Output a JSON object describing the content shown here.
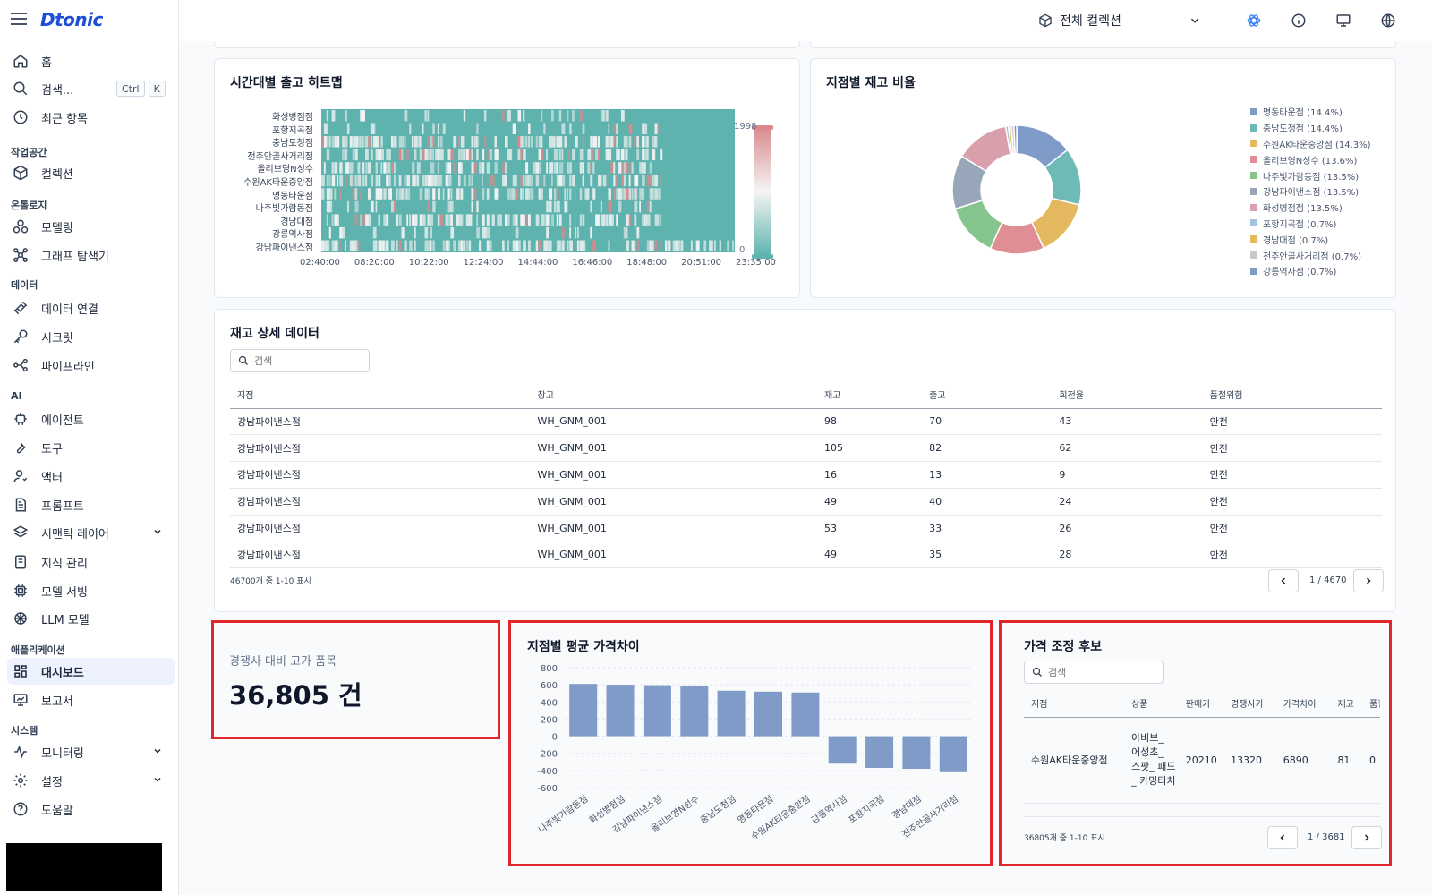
{
  "brand": {
    "name": "Dtonic"
  },
  "nav": {
    "home": "홈",
    "search": "검색...",
    "search_kbd_ctrl": "Ctrl",
    "search_kbd_k": "K",
    "recent": "최근 항목",
    "section_workspace": "작업공간",
    "collections": "컬렉션",
    "section_ontology": "온톨로지",
    "modeling": "모델링",
    "graph_explorer": "그래프 탐색기",
    "section_data": "데이터",
    "data_connection": "데이터 연결",
    "secrets": "시크릿",
    "pipeline": "파이프라인",
    "section_ai": "AI",
    "agent": "에이전트",
    "tools": "도구",
    "actor": "액터",
    "prompt": "프롬프트",
    "semantic_layer": "시맨틱 레이어",
    "knowledge": "지식 관리",
    "model_serving": "모델 서빙",
    "llm_model": "LLM 모델",
    "section_apps": "애플리케이션",
    "dashboard": "대시보드",
    "report": "보고서",
    "section_system": "시스템",
    "monitoring": "모니터링",
    "settings": "설정",
    "help": "도움말"
  },
  "topbar": {
    "collection_label": "전체 컬렉션"
  },
  "heatmap": {
    "title": "시간대별 출고 히트맵",
    "stores": [
      "화성병점점",
      "포항지곡점",
      "충남도청점",
      "전주안골사거리점",
      "올리브영N성수",
      "수원AK타운중앙점",
      "명동타운점",
      "나주빛가람동점",
      "경남대점",
      "강릉역사점",
      "강남파이낸스점"
    ],
    "times": [
      "02:40:00",
      "08:20:00",
      "10:22:00",
      "12:24:00",
      "14:44:00",
      "16:46:00",
      "18:48:00",
      "20:51:00",
      "23:35:00"
    ],
    "scale_max": "1998",
    "scale_min": "0",
    "colors": {
      "low": "#5fb3ae",
      "mid": "#f4f4f4",
      "high": "#d98a8d"
    }
  },
  "donut": {
    "title": "지점별 재고 비율",
    "chart_data": {
      "type": "pie",
      "title": "지점별 재고 비율",
      "labels": [
        "명동타운점",
        "충남도청점",
        "수원AK타운중앙점",
        "올리브영N성수",
        "나주빛가람동점",
        "강남파이낸스점",
        "화성병점점",
        "포항지곡점",
        "경남대점",
        "전주안골사거리점",
        "강릉역사점"
      ],
      "values": [
        14.4,
        14.4,
        14.3,
        13.6,
        13.5,
        13.5,
        13.5,
        0.7,
        0.7,
        0.7,
        0.7
      ],
      "legend": [
        "명동타운점 (14.4%)",
        "충남도청점 (14.4%)",
        "수원AK타운중앙점 (14.3%)",
        "올리브영N성수 (13.6%)",
        "나주빛가람동점 (13.5%)",
        "강남파이낸스점 (13.5%)",
        "화성병점점 (13.5%)",
        "포항지곡점 (0.7%)",
        "경남대점 (0.7%)",
        "전주안골사거리점 (0.7%)",
        "강릉역사점 (0.7%)"
      ],
      "colors": [
        "#7f9cc8",
        "#6dbab6",
        "#e3b85e",
        "#e08e95",
        "#86c48d",
        "#98a6b9",
        "#d9a0ac",
        "#a5c4e0",
        "#e3b85e",
        "#c5c8cc",
        "#7f9cc8"
      ],
      "legend_position": "right"
    }
  },
  "inventory_table": {
    "title": "재고 상세 데이터",
    "search_placeholder": "검색",
    "headers": [
      "지점",
      "창고",
      "재고",
      "출고",
      "회전율",
      "품절위험"
    ],
    "rows": [
      [
        "강남파이낸스점",
        "WH_GNM_001",
        "98",
        "70",
        "43",
        "안전"
      ],
      [
        "강남파이낸스점",
        "WH_GNM_001",
        "105",
        "82",
        "62",
        "안전"
      ],
      [
        "강남파이낸스점",
        "WH_GNM_001",
        "16",
        "13",
        "9",
        "안전"
      ],
      [
        "강남파이낸스점",
        "WH_GNM_001",
        "49",
        "40",
        "24",
        "안전"
      ],
      [
        "강남파이낸스점",
        "WH_GNM_001",
        "53",
        "33",
        "26",
        "안전"
      ],
      [
        "강남파이낸스점",
        "WH_GNM_001",
        "49",
        "35",
        "28",
        "안전"
      ]
    ],
    "row_count": "46700개 중 1-10 표시",
    "page": "1 / 4670"
  },
  "kpi": {
    "label": "경쟁사 대비 고가 품목",
    "value": "36,805 건"
  },
  "price_gap": {
    "title": "지점별 평균 가격차이",
    "chart_data": {
      "type": "bar",
      "title": "지점별 평균 가격차이",
      "categories": [
        "나주빛가람동점",
        "화성병점점",
        "강남파이낸스점",
        "올리브영N성수",
        "충남도청점",
        "명동타운점",
        "수원AK타운중앙점",
        "강릉역사점",
        "포항지곡점",
        "경남대점",
        "전주안골사거리점"
      ],
      "values": [
        610,
        600,
        595,
        585,
        530,
        520,
        510,
        -320,
        -370,
        -380,
        -420
      ],
      "yticks": [
        "800",
        "600",
        "400",
        "200",
        "0",
        "-200",
        "-400",
        "-600"
      ],
      "ylim": [
        -600,
        800
      ],
      "color": "#7f9cc8",
      "grid": true
    }
  },
  "price_candidates": {
    "title": "가격 조정 후보",
    "search_placeholder": "검색",
    "headers": [
      "지점",
      "상품",
      "판매가",
      "경쟁사가",
      "가격차이",
      "재고",
      "품절위"
    ],
    "rows": [
      [
        "수원AK타운중앙점",
        "아비브_ 어성초_ 스팟_ 패드_ 카밍터치",
        "20210",
        "13320",
        "6890",
        "81",
        "0"
      ]
    ],
    "row_count": "36805개 중 1-10 표시",
    "page": "1 / 3681"
  }
}
